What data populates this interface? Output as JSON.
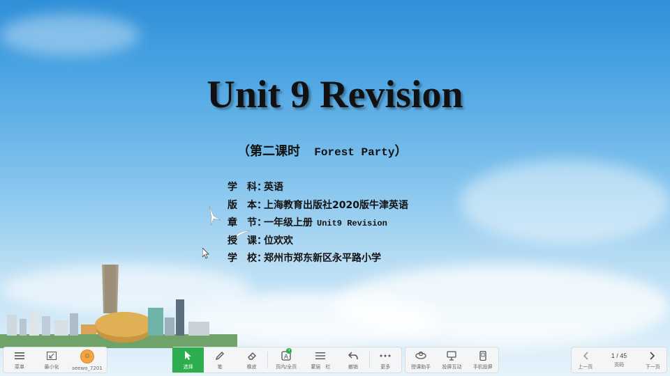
{
  "slide": {
    "title": "Unit 9 Revision",
    "subtitle_cn": "（第二课时",
    "subtitle_en": "Forest Party",
    "subtitle_close": "）",
    "info": [
      {
        "label": "学　科：",
        "value": "英语",
        "extra": ""
      },
      {
        "label": "版　本：",
        "value": "上海教育出版社2020版牛津英语",
        "extra": ""
      },
      {
        "label": "章　节：",
        "value": "一年级上册",
        "extra": "Unit9 Revision"
      },
      {
        "label": "授　课：",
        "value": "位欢欢",
        "extra": ""
      },
      {
        "label": "学　校：",
        "value": "郑州市郑东新区永平路小学",
        "extra": ""
      }
    ]
  },
  "toolbar": {
    "left": [
      {
        "icon": "menu-icon",
        "label": "菜单"
      },
      {
        "icon": "minimize-icon",
        "label": "最小化"
      },
      {
        "icon": "user-avatar-icon",
        "label": "seewo_7201"
      }
    ],
    "center": [
      {
        "icon": "cursor-select-icon",
        "label": "选择"
      },
      {
        "icon": "pen-icon",
        "label": "笔"
      },
      {
        "icon": "eraser-icon",
        "label": "橡皮"
      },
      {
        "icon": "text-icon",
        "label": "页内/全页"
      },
      {
        "icon": "list-icon",
        "label": "蒙层　栏"
      },
      {
        "icon": "undo-icon",
        "label": "撤销"
      },
      {
        "icon": "more-icon",
        "label": "更多"
      }
    ],
    "tools": [
      {
        "icon": "classroom-tool-icon",
        "label": "授课助手"
      },
      {
        "icon": "screen-share-icon",
        "label": "投屏互动"
      },
      {
        "icon": "phone-control-icon",
        "label": "手机投屏"
      }
    ],
    "nav": {
      "prev_label": "上一页",
      "page": "1 / 45",
      "page_label": "页码",
      "next_label": "下一页"
    }
  },
  "colors": {
    "accent": "#2eaf4f",
    "sky_top": "#2f8fd8",
    "sky_bottom": "#e6f3fb"
  }
}
